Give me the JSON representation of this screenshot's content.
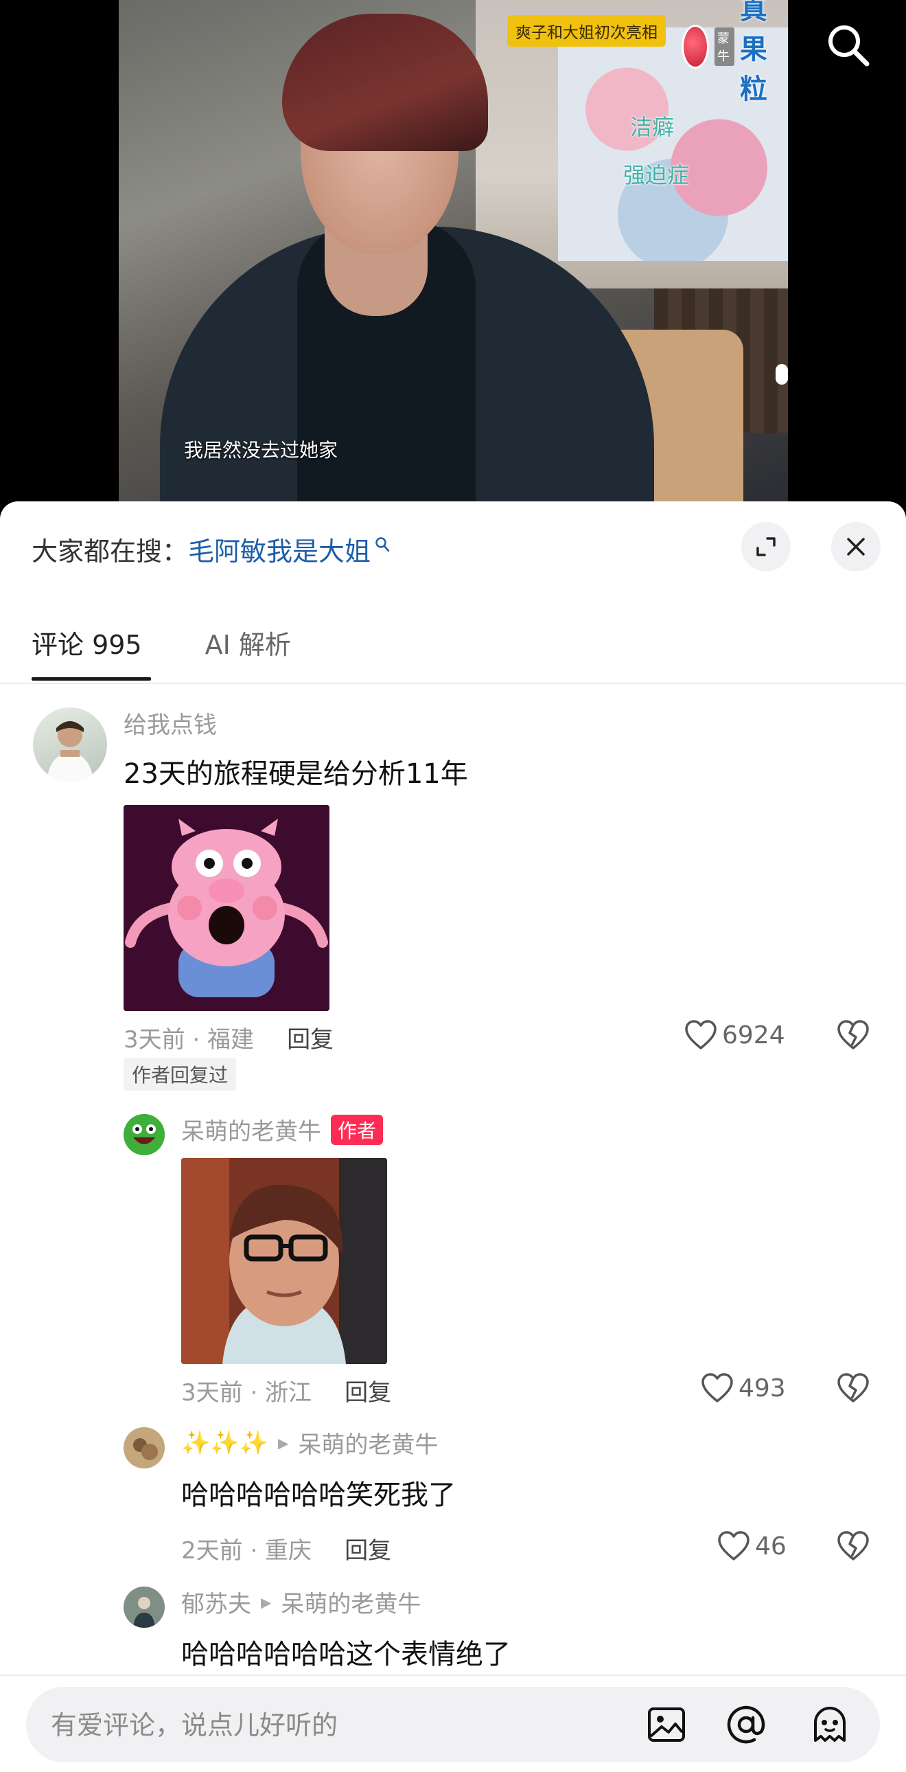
{
  "video": {
    "tag": "爽子和大姐初次亮相",
    "brand": "真果粒",
    "brand_small": "蒙牛",
    "note1": "洁癖",
    "note2": "强迫症",
    "subtitle": "我居然没去过她家"
  },
  "panel": {
    "hot_label": "大家都在搜：",
    "hot_link": "毛阿敏我是大姐",
    "tabs": [
      {
        "label": "评论 995",
        "active": true
      },
      {
        "label": "AI 解析",
        "active": false
      }
    ]
  },
  "comments": [
    {
      "user": "给我点钱",
      "text": "23天的旅程硬是给分析11年",
      "time": "3天前 · 福建",
      "reply": "回复",
      "likes": "6924",
      "badge": "作者回复过"
    }
  ],
  "replies": [
    {
      "user": "呆萌的老黄牛",
      "author_badge": "作者",
      "time": "3天前 · 浙江",
      "reply": "回复",
      "likes": "493"
    },
    {
      "user": "✨✨✨",
      "reply_to": "呆萌的老黄牛",
      "text": "哈哈哈哈哈哈笑死我了",
      "time": "2天前 · 重庆",
      "reply": "回复",
      "likes": "46"
    },
    {
      "user": "郁苏夫",
      "reply_to": "呆萌的老黄牛",
      "text": "哈哈哈哈哈哈这个表情绝了"
    }
  ],
  "input": {
    "placeholder": "有爱评论，说点儿好听的"
  },
  "colors": {
    "accent": "#fe2c55",
    "link": "#1d5ea8"
  },
  "icons": [
    "search-icon",
    "expand-icon",
    "close-icon",
    "heart-icon",
    "broken-heart-icon",
    "image-icon",
    "at-icon",
    "emoji-icon",
    "search-small-icon"
  ]
}
